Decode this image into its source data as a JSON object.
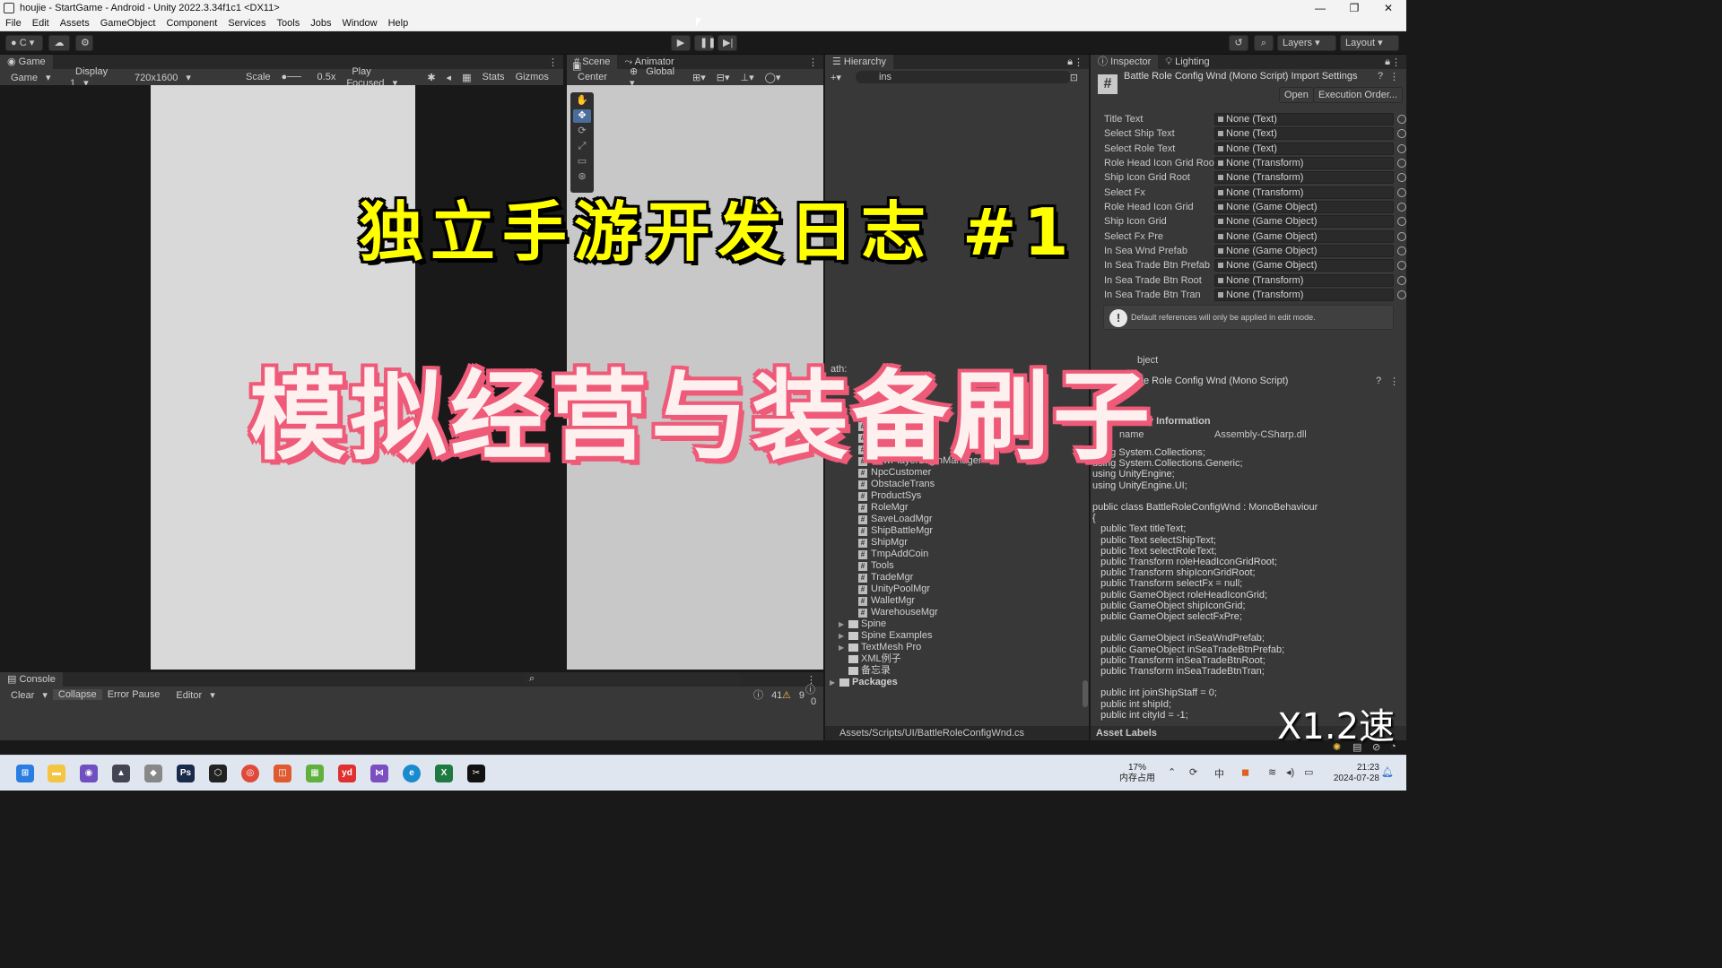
{
  "window": {
    "title": "houjie - StartGame - Android - Unity 2022.3.34f1c1 <DX11>"
  },
  "menu": [
    "File",
    "Edit",
    "Assets",
    "GameObject",
    "Component",
    "Services",
    "Tools",
    "Jobs",
    "Window",
    "Help"
  ],
  "toolbar": {
    "account": "C",
    "layers": "Layers",
    "layout": "Layout"
  },
  "game": {
    "tab": "Game",
    "mode": "Game",
    "display": "Display 1",
    "resolution": "720x1600",
    "scale_label": "Scale",
    "scale_value": "0.5x",
    "play_focused": "Play Focused",
    "stats": "Stats",
    "gizmos": "Gizmos"
  },
  "scene": {
    "tab": "Scene",
    "tab2": "Animator",
    "pivot": "Center",
    "space": "Global"
  },
  "hierarchy": {
    "tab": "Hierarchy",
    "search": "ins",
    "path_label": "ath:"
  },
  "project": {
    "scripts": [
      "GameMgr",
      "GameRoot",
      "GoFishingMgr",
      "LoadSceneMgr",
      "NewPlayerLoginManager",
      "NpcCustomer",
      "ObstacleTrans",
      "ProductSys",
      "RoleMgr",
      "SaveLoadMgr",
      "ShipBattleMgr",
      "ShipMgr",
      "TmpAddCoin",
      "Tools",
      "TradeMgr",
      "UnityPoolMgr",
      "WalletMgr",
      "WarehouseMgr"
    ],
    "folders": [
      "Spine",
      "Spine Examples",
      "TextMesh Pro"
    ],
    "files": [
      "XML例子",
      "备忘录"
    ],
    "packages": "Packages",
    "path": "Assets/Scripts/UI/BattleRoleConfigWnd.cs"
  },
  "inspector": {
    "tab": "Inspector",
    "tab2": "Lighting",
    "header": "Battle Role Config Wnd (Mono Script) Import Settings",
    "open": "Open",
    "exec_order": "Execution Order...",
    "fields": [
      {
        "label": "Title Text",
        "value": "None (Text)"
      },
      {
        "label": "Select Ship Text",
        "value": "None (Text)"
      },
      {
        "label": "Select Role Text",
        "value": "None (Text)"
      },
      {
        "label": "Role Head Icon Grid Root",
        "value": "None (Transform)"
      },
      {
        "label": "Ship Icon Grid Root",
        "value": "None (Transform)"
      },
      {
        "label": "Select Fx",
        "value": "None (Transform)"
      },
      {
        "label": "Role Head Icon Grid",
        "value": "None (Game Object)"
      },
      {
        "label": "Ship Icon Grid",
        "value": "None (Game Object)"
      },
      {
        "label": "Select Fx Pre",
        "value": "None (Game Object)"
      },
      {
        "label": "In Sea Wnd Prefab",
        "value": "None (Game Object)"
      },
      {
        "label": "In Sea Trade Btn Prefab",
        "value": "None (Game Object)"
      },
      {
        "label": "In Sea Trade Btn Root",
        "value": "None (Transform)"
      },
      {
        "label": "In Sea Trade Btn Tran",
        "value": "None (Transform)"
      }
    ],
    "notice": "Default references will only be applied in edit mode.",
    "object_label": "bject",
    "script_header": "Battle Role Config Wnd (Mono Script)",
    "assembly_title": "ssembly Information",
    "assembly_key": "name",
    "assembly_value": "Assembly-CSharp.dll",
    "code": "using System.Collections;\nusing System.Collections.Generic;\nusing UnityEngine;\nusing UnityEngine.UI;\n\npublic class BattleRoleConfigWnd : MonoBehaviour\n{\n   public Text titleText;\n   public Text selectShipText;\n   public Text selectRoleText;\n   public Transform roleHeadIconGridRoot;\n   public Transform shipIconGridRoot;\n   public Transform selectFx = null;\n   public GameObject roleHeadIconGrid;\n   public GameObject shipIconGrid;\n   public GameObject selectFxPre;\n\n   public GameObject inSeaWndPrefab;\n   public GameObject inSeaTradeBtnPrefab;\n   public Transform inSeaTradeBtnRoot;\n   public Transform inSeaTradeBtnTran;\n\n   public int joinShipStaff = 0;\n   public int shipId;\n   public int cityId = -1;",
    "asset_labels": "Asset Labels"
  },
  "console": {
    "tab": "Console",
    "clear": "Clear",
    "collapse": "Collapse",
    "error_pause": "Error Pause",
    "editor": "Editor",
    "count_log": "41",
    "count_warn": "9",
    "count_err": "0"
  },
  "overlay": {
    "title": "独立手游开发日志 #1",
    "subtitle": "模拟经营与装备刷子",
    "speed": "X1.2速"
  },
  "taskbar": {
    "mem_percent": "17%",
    "mem_label": "内存占用",
    "time": "21:23",
    "date": "2024-07-28"
  }
}
